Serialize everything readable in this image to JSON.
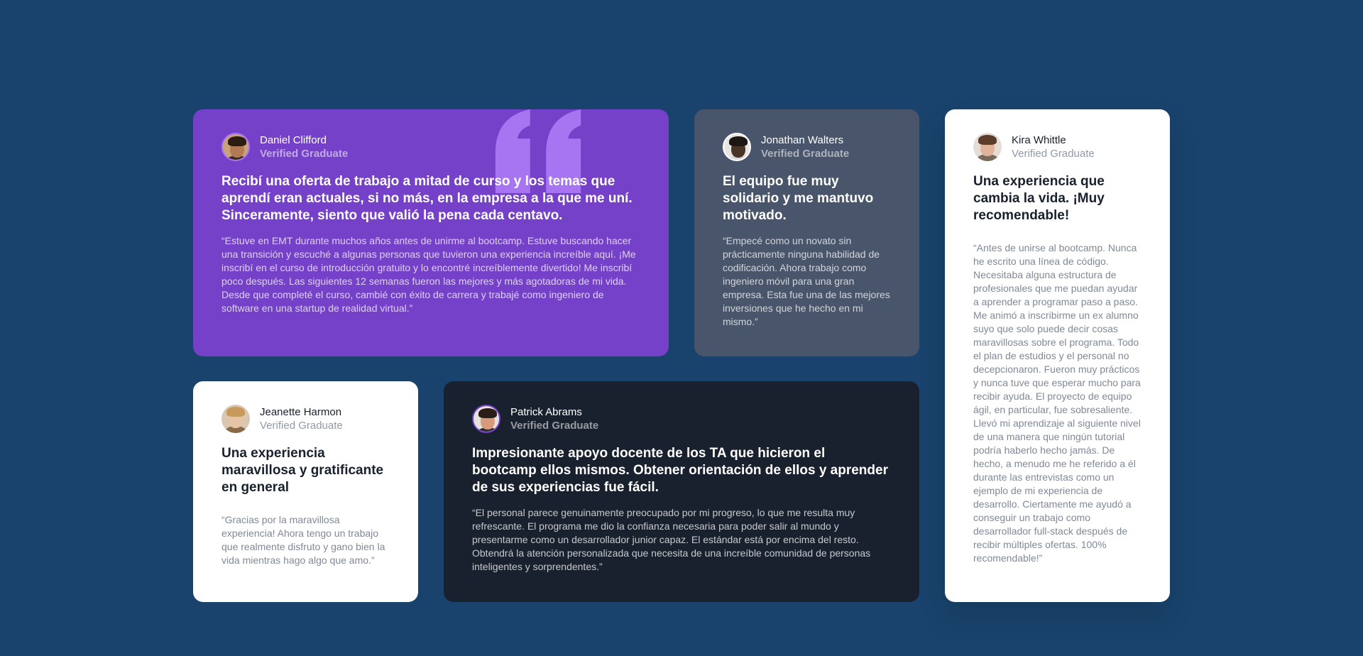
{
  "testimonials": [
    {
      "name": "Daniel Clifford",
      "role": "Verified Graduate",
      "headline": "Recibí una oferta de trabajo a mitad de curso y los temas que aprendí eran actuales, si no más, en la empresa a la que me uní. Sinceramente, siento que valió la pena cada centavo.",
      "body": "“Estuve en EMT durante muchos años antes de unirme al bootcamp. Estuve buscando hacer una transición y escuché a algunas personas que tuvieron una experiencia increíble aquí. ¡Me inscribí en el curso de introducción gratuito y lo encontré increíblemente divertido! Me inscribí poco después. Las siguientes 12 semanas fueron las mejores y más agotadoras de mi vida. Desde que completé el curso, cambié con éxito de carrera y trabajé como ingeniero de software en una startup de realidad virtual.”",
      "background": "#7541c8",
      "icon": "quote-icon"
    },
    {
      "name": "Jonathan Walters",
      "role": "Verified Graduate",
      "headline": "El equipo fue muy solidario y me mantuvo motivado.",
      "body": "“Empecé como un novato sin prácticamente ninguna habilidad de codificación. Ahora trabajo como ingeniero móvil para una gran empresa. Esta fue una de las mejores inversiones que he hecho en mi mismo.”",
      "background": "#48556a"
    },
    {
      "name": "Kira Whittle",
      "role": "Verified Graduate",
      "headline": "Una experiencia que cambia la vida. ¡Muy recomendable!",
      "body": "“Antes de unirse al bootcamp. Nunca he escrito una línea de código. Necesitaba alguna estructura de profesionales que me puedan ayudar a aprender a programar paso a paso. Me animó a inscribirme un ex alumno suyo que solo puede decir cosas maravillosas sobre el programa. Todo el plan de estudios y el personal no decepcionaron. Fueron muy prácticos y nunca tuve que esperar mucho para recibir ayuda. El proyecto de equipo ágil, en particular, fue sobresaliente. Llevó mi aprendizaje al siguiente nivel de una manera que ningún tutorial podría haberlo hecho jamás. De hecho, a menudo me he referido a él durante las entrevistas como un ejemplo de mi experiencia de desarrollo. Ciertamente me ayudó a conseguir un trabajo como desarrollador full-stack después de recibir múltiples ofertas. 100% recomendable!”",
      "background": "#ffffff"
    },
    {
      "name": "Jeanette Harmon",
      "role": "Verified Graduate",
      "headline": "Una experiencia maravillosa y gratificante en general",
      "body": "“Gracias por la maravillosa experiencia! Ahora tengo un trabajo que realmente disfruto y gano bien la vida mientras hago algo que amo.”",
      "background": "#ffffff"
    },
    {
      "name": "Patrick Abrams",
      "role": "Verified Graduate",
      "headline": "Impresionante apoyo docente de los TA que hicieron el bootcamp ellos mismos. Obtener orientación de ellos y aprender de sus experiencias fue fácil.",
      "body": "“El personal parece genuinamente preocupado por mi progreso, lo que me resulta muy refrescante. El programa me dio la confianza necesaria para poder salir al mundo y presentarme como un desarrollador junior capaz. El estándar está por encima del resto. Obtendrá la atención personalizada que necesita de una increíble comunidad de personas inteligentes y sorprendentes.”",
      "background": "#19212e"
    }
  ],
  "colors": {
    "page_background": "#19436c",
    "violet": "#7541c8",
    "grayish_blue": "#48556a",
    "dark_blackish_blue": "#19212e",
    "white": "#ffffff",
    "quote_mark": "#a775f1"
  }
}
